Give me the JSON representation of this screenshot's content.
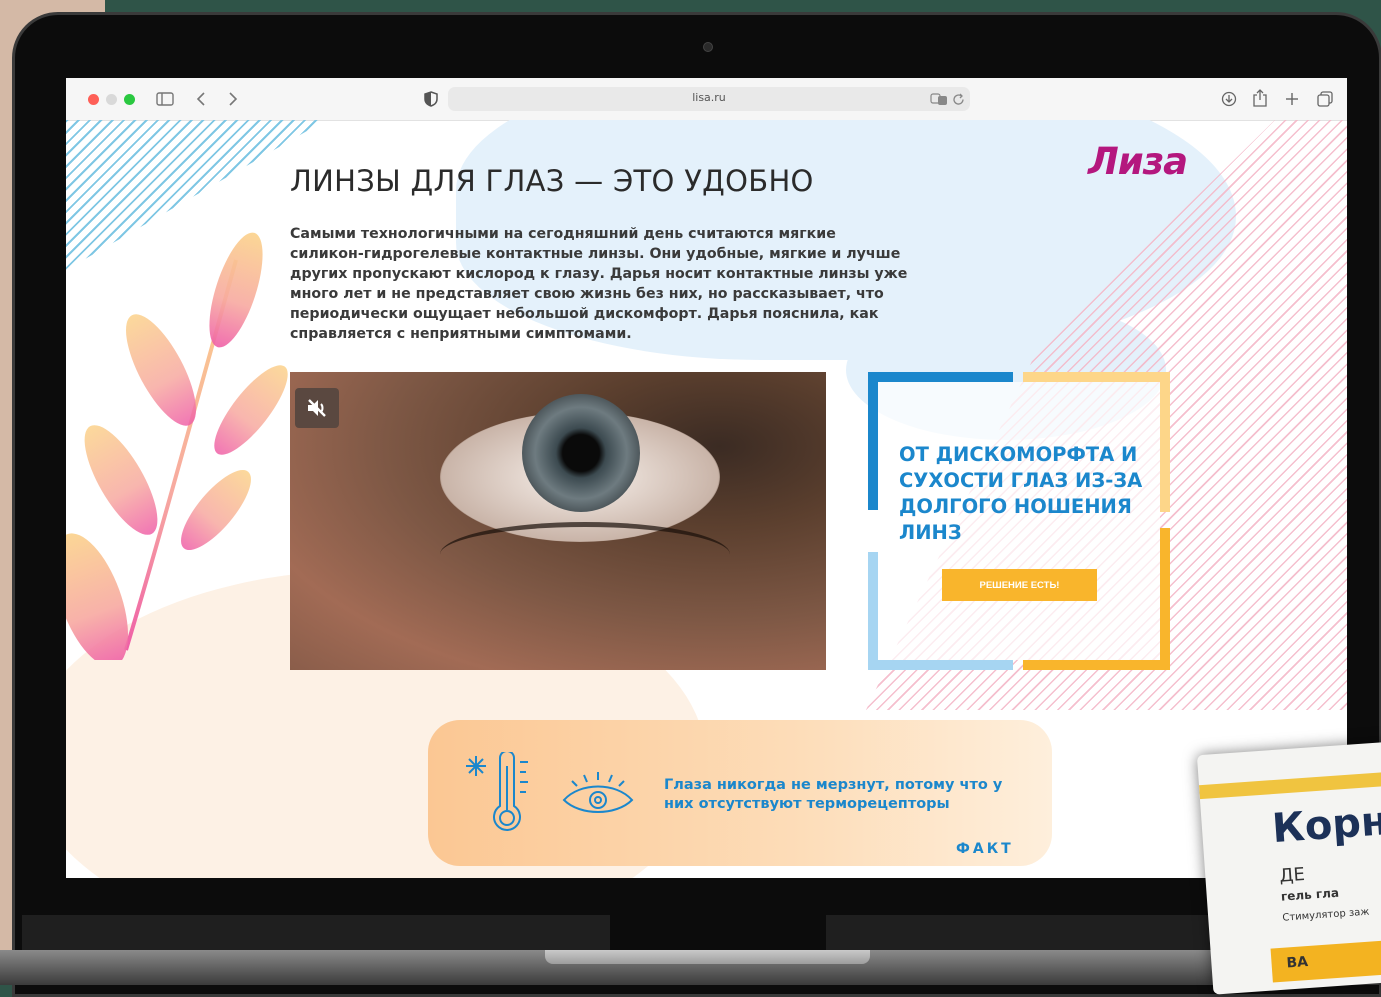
{
  "browser": {
    "url": "lisa.ru"
  },
  "site": {
    "logo": "Лиза",
    "title": "ЛИНЗЫ ДЛЯ ГЛАЗ — ЭТО УДОБНО",
    "body": "Самыми технологичными на сегодняшний день считаются мягкие силикон-гидрогелевые контактные линзы. Они удобные, мягкие и лучше других пропускают кислород к глазу. Дарья носит контактные линзы уже много лет и не представляет свою жизнь без них, но рассказывает, что периодически ощущает небольшой дискомфорт. Дарья пояснила, как справляется с неприятными симптомами."
  },
  "promo": {
    "title": "ОТ ДИСКОМОРФТА И СУХОСТИ ГЛАЗ ИЗ-ЗА ДОЛГОГО НОШЕНИЯ ЛИНЗ",
    "button": "РЕШЕНИЕ ЕСТЬ!",
    "accent": "#1b87cc",
    "button_color": "#f9b52c"
  },
  "fact": {
    "text": "Глаза никогда не мерзнут, потому что у них отсутствуют терморецепторы",
    "label": "ФАКТ"
  },
  "product": {
    "name": "Корн",
    "line1": "ДЕ",
    "line2": "гель гла",
    "line3": "Стимулятор заж",
    "footer": "BA"
  },
  "colors": {
    "brand": "#b4177e",
    "text": "#2b2b2b"
  }
}
